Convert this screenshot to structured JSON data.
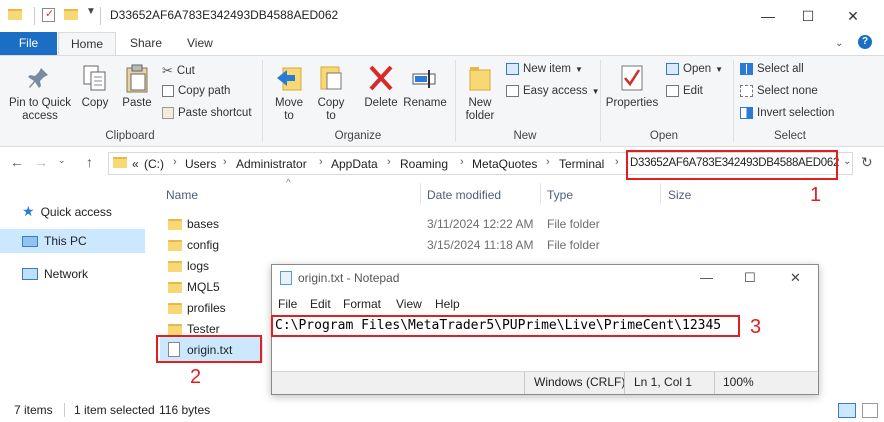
{
  "window": {
    "title": "D33652AF6A783E342493DB4588AED062",
    "minimize": "—",
    "maximize": "☐",
    "close": "✕"
  },
  "ribbon_tabs": [
    "File",
    "Home",
    "Share",
    "View"
  ],
  "ribbon": {
    "clipboard": {
      "label": "Clipboard",
      "pin": "Pin to Quick access",
      "pin_l1": "Pin to Quick",
      "pin_l2": "access",
      "copy": "Copy",
      "paste": "Paste",
      "cut": "Cut",
      "copy_path": "Copy path",
      "paste_shortcut": "Paste shortcut"
    },
    "organize": {
      "label": "Organize",
      "move_to": "Move to",
      "move_l1": "Move",
      "move_l2": "to",
      "copy_to": "Copy to",
      "copy_l1": "Copy",
      "copy_l2": "to",
      "delete": "Delete",
      "rename": "Rename"
    },
    "new": {
      "label": "New",
      "new_folder_l1": "New",
      "new_folder_l2": "folder",
      "new_item": "New item",
      "easy_access": "Easy access"
    },
    "open": {
      "label": "Open",
      "properties": "Properties",
      "open": "Open",
      "edit": "Edit"
    },
    "select": {
      "label": "Select",
      "select_all": "Select all",
      "select_none": "Select none",
      "invert": "Invert selection"
    }
  },
  "address": {
    "prefix": "«",
    "crumbs": [
      "(C:)",
      "Users",
      "Administrator",
      "AppData",
      "Roaming",
      "MetaQuotes",
      "Terminal",
      "D33652AF6A783E342493DB4588AED062"
    ]
  },
  "nav": {
    "quick_access": "Quick access",
    "this_pc": "This PC",
    "network": "Network"
  },
  "columns": {
    "name": "Name",
    "date": "Date modified",
    "type": "Type",
    "size": "Size"
  },
  "files": [
    {
      "name": "bases",
      "date": "3/11/2024 12:22 AM",
      "type": "File folder"
    },
    {
      "name": "config",
      "date": "3/15/2024 11:18 AM",
      "type": "File folder"
    },
    {
      "name": "logs",
      "date": "",
      "type": ""
    },
    {
      "name": "MQL5",
      "date": "",
      "type": ""
    },
    {
      "name": "profiles",
      "date": "",
      "type": ""
    },
    {
      "name": "Tester",
      "date": "",
      "type": ""
    },
    {
      "name": "origin.txt",
      "date": "",
      "type": ""
    }
  ],
  "status": {
    "items": "7 items",
    "selected": "1 item selected",
    "size": "116 bytes"
  },
  "notepad": {
    "title": "origin.txt - Notepad",
    "menu": [
      "File",
      "Edit",
      "Format",
      "View",
      "Help"
    ],
    "content": "C:\\Program Files\\MetaTrader5\\PUPrime\\Live\\PrimeCent\\12345",
    "encoding_line": "Windows (CRLF)",
    "position": "Ln 1, Col 1",
    "zoom": "100%"
  },
  "annotations": [
    "1",
    "2",
    "3"
  ],
  "colors": {
    "accent": "#1a6fc4",
    "selection": "#cce8ff",
    "annotation_red": "#e02020"
  }
}
